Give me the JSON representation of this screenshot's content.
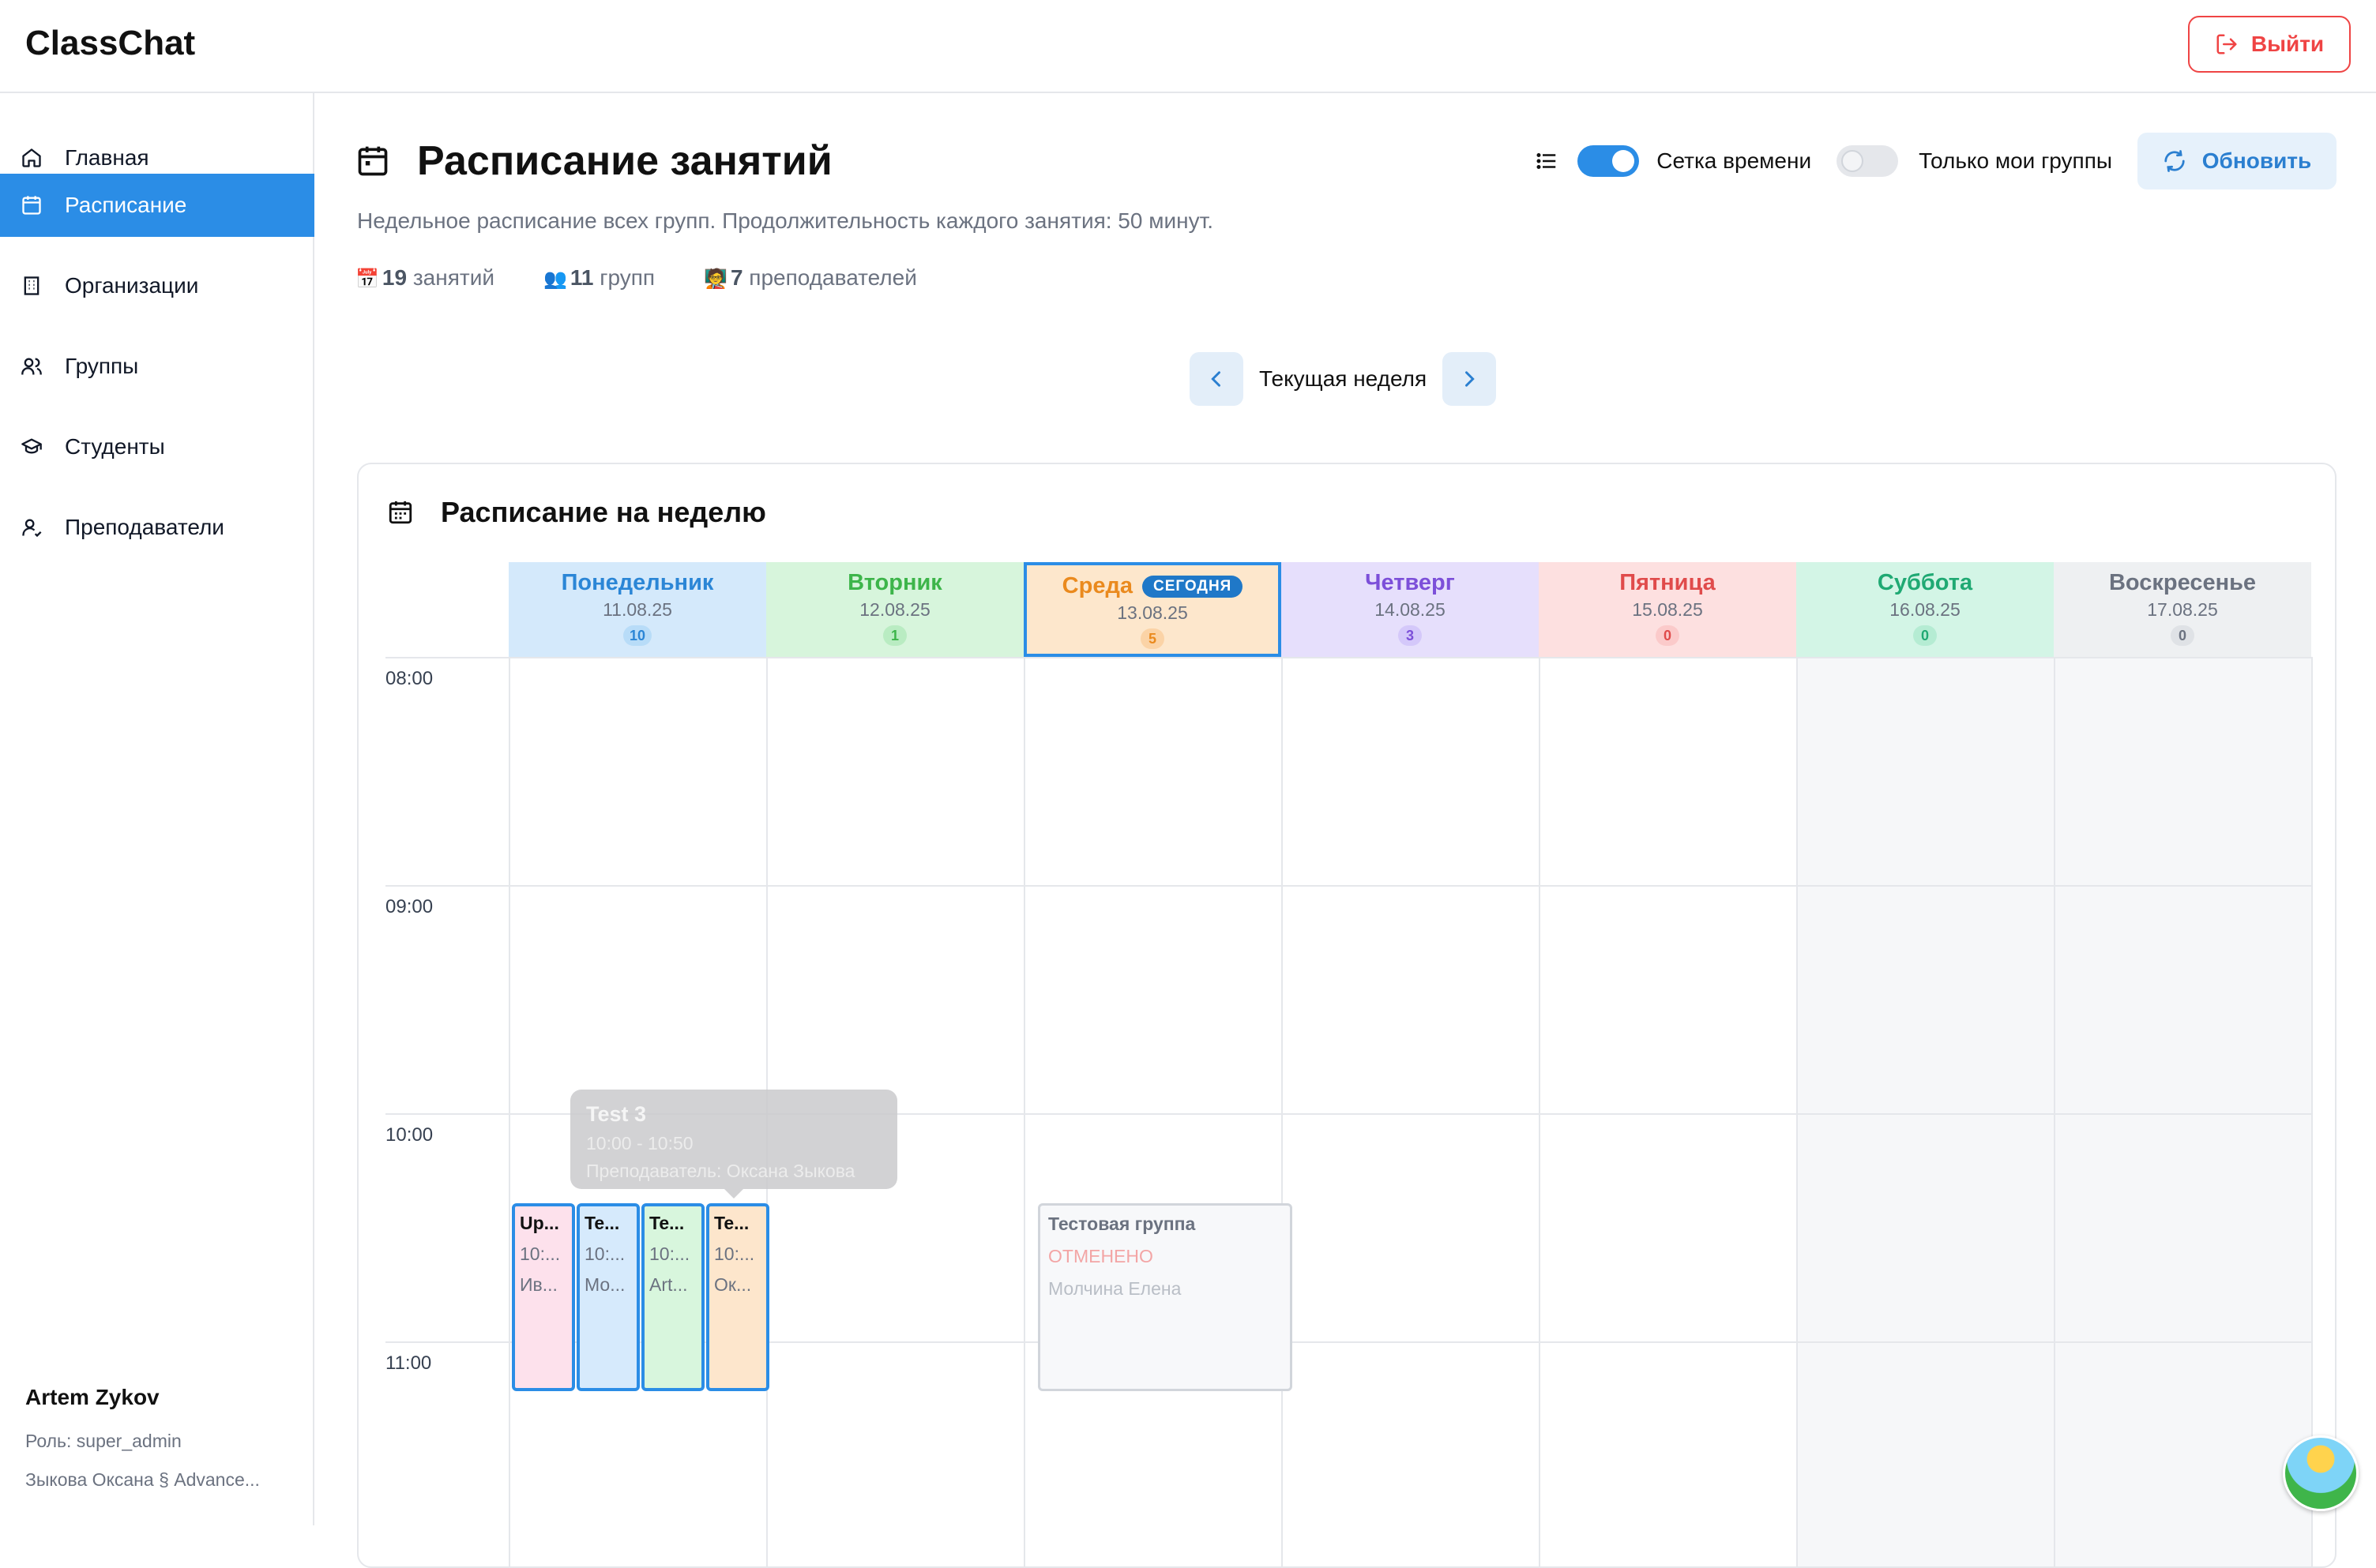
{
  "app": {
    "brand": "ClassChat",
    "logout_label": "Выйти"
  },
  "sidebar": {
    "items": [
      {
        "label": "Главная",
        "icon": "home-icon"
      },
      {
        "label": "Расписание",
        "icon": "calendar-icon",
        "active": true
      },
      {
        "label": "Организации",
        "icon": "building-icon"
      },
      {
        "label": "Группы",
        "icon": "users-icon"
      },
      {
        "label": "Студенты",
        "icon": "graduation-cap-icon"
      },
      {
        "label": "Преподаватели",
        "icon": "user-icon"
      }
    ],
    "user": {
      "name": "Artem Zykov",
      "role": "Роль: super_admin",
      "org": "Зыкова Оксана § Advance..."
    }
  },
  "page": {
    "title": "Расписание занятий",
    "subtitle": "Недельное расписание всех групп. Продолжительность каждого занятия: 50 минут.",
    "stats": [
      {
        "emoji": "📅",
        "value": "19",
        "label": "занятий"
      },
      {
        "emoji": "👥",
        "value": "11",
        "label": "групп"
      },
      {
        "emoji": "🧑‍🏫",
        "value": "7",
        "label": "преподавателей"
      }
    ],
    "controls": {
      "time_grid_label": "Сетка времени",
      "time_grid_on": true,
      "my_groups_label": "Только мои группы",
      "my_groups_on": false,
      "refresh_label": "Обновить"
    },
    "week_nav": {
      "label": "Текущая неделя"
    }
  },
  "schedule": {
    "title": "Расписание на неделю",
    "today_badge": "СЕГОДНЯ",
    "days": [
      {
        "name": "Понедельник",
        "date": "11.08.25",
        "count": "10",
        "color": "#2b86d6",
        "bg": "#d4e9fb",
        "chip": "#b8dcf8"
      },
      {
        "name": "Вторник",
        "date": "12.08.25",
        "count": "1",
        "color": "#3db54a",
        "bg": "#d7f5dc",
        "chip": "#b9ecc2"
      },
      {
        "name": "Среда",
        "date": "13.08.25",
        "count": "5",
        "color": "#ea8a1e",
        "bg": "#fde7cc",
        "chip": "#fbd3a6",
        "today": true
      },
      {
        "name": "Четверг",
        "date": "14.08.25",
        "count": "3",
        "color": "#7c4fd9",
        "bg": "#e6dffc",
        "chip": "#d4c8fa"
      },
      {
        "name": "Пятница",
        "date": "15.08.25",
        "count": "0",
        "color": "#e04b4b",
        "bg": "#fde0e0",
        "chip": "#fbcaca"
      },
      {
        "name": "Суббота",
        "date": "16.08.25",
        "count": "0",
        "color": "#1fa973",
        "bg": "#d3f5e6",
        "chip": "#b5ecd3"
      },
      {
        "name": "Воскресенье",
        "date": "17.08.25",
        "count": "0",
        "color": "#6b7280",
        "bg": "#eef0f2",
        "chip": "#dfe2e6"
      }
    ],
    "hours": [
      "08:00",
      "09:00",
      "10:00",
      "11:00"
    ],
    "lessons": [
      {
        "title": "Up...",
        "time": "10:...",
        "teacher": "Ив...",
        "bg": "#fde1ec"
      },
      {
        "title": "Te...",
        "time": "10:...",
        "teacher": "Мо...",
        "bg": "#d6eafc"
      },
      {
        "title": "Te...",
        "time": "10:...",
        "teacher": "Art...",
        "bg": "#d8f6dd"
      },
      {
        "title": "Te...",
        "time": "10:...",
        "teacher": "Ок...",
        "bg": "#fde6cc"
      }
    ],
    "cancelled_lesson": {
      "title": "Тестовая группа",
      "status": "ОТМЕНЕНО",
      "teacher": "Молчина Елена"
    },
    "tooltip": {
      "title": "Test 3",
      "time": "10:00 - 10:50",
      "teacher": "Преподаватель: Оксана Зыкова"
    }
  }
}
